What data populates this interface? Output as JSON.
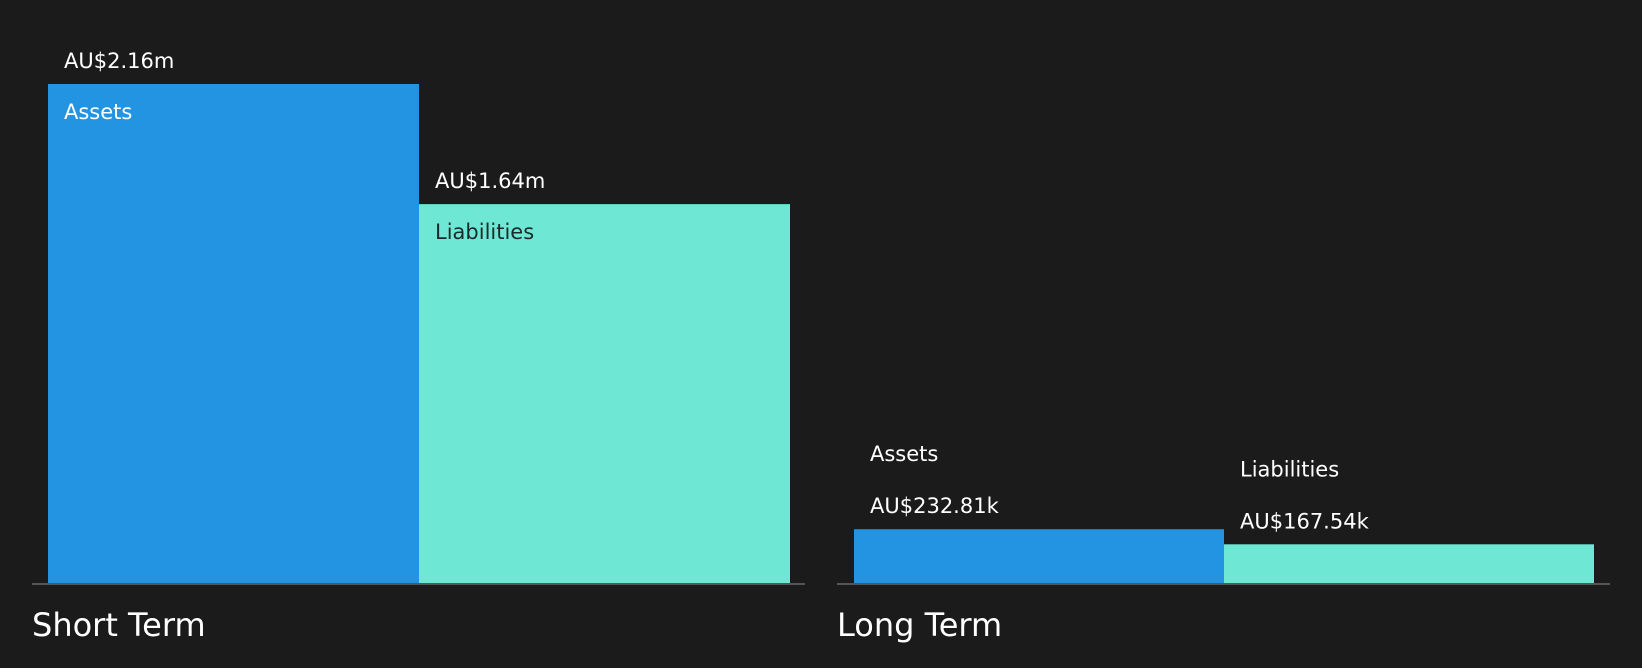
{
  "chart_data": {
    "type": "bar",
    "groups": [
      {
        "label": "Short Term",
        "bars": [
          {
            "name": "Assets",
            "value": 2160000,
            "value_label": "AU$2.16m",
            "color": "#2394e1",
            "text_color": "#ffffff"
          },
          {
            "name": "Liabilities",
            "value": 1640000,
            "value_label": "AU$1.64m",
            "color": "#6ee7d4",
            "text_color": "#1b2b2b"
          }
        ]
      },
      {
        "label": "Long Term",
        "bars": [
          {
            "name": "Assets",
            "value": 232810,
            "value_label": "AU$232.81k",
            "color": "#2394e1",
            "text_color": "#ffffff"
          },
          {
            "name": "Liabilities",
            "value": 167540,
            "value_label": "AU$167.54k",
            "color": "#6ee7d4",
            "text_color": "#ffffff"
          }
        ]
      }
    ],
    "ylim": [
      0,
      2160000
    ]
  },
  "colors": {
    "background": "#1b1b1b",
    "baseline": "#555555",
    "text": "#ffffff"
  }
}
